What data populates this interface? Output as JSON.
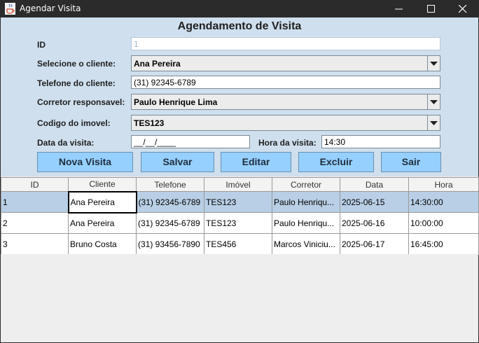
{
  "window": {
    "title": "Agendar Visita"
  },
  "form": {
    "title": "Agendamento de Visita",
    "id_label": "ID",
    "id_value": "1",
    "cliente_label": "Selecione o cliente:",
    "cliente_value": "Ana Pereira",
    "telefone_label": "Telefone do cliente:",
    "telefone_value": "(31) 92345-6789",
    "corretor_label": "Corretor responsavel:",
    "corretor_value": "Paulo Henrique Lima",
    "imovel_label": "Codigo do imovel:",
    "imovel_value": "TES123",
    "data_label": "Data da visita:",
    "data_value": "__/__/____",
    "hora_label": "Hora da visita:",
    "hora_value": "14:30"
  },
  "buttons": {
    "nova": "Nova Visita",
    "salvar": "Salvar",
    "editar": "Editar",
    "excluir": "Excluir",
    "sair": "Sair"
  },
  "table": {
    "headers": [
      "ID",
      "Cliente",
      "Telefone",
      "Imóvel",
      "Corretor",
      "Data",
      "Hora"
    ],
    "rows": [
      [
        "1",
        "Ana Pereira",
        "(31) 92345-6789",
        "TES123",
        "Paulo Henriqu...",
        "2025-06-15",
        "14:30:00"
      ],
      [
        "2",
        "Ana Pereira",
        "(31) 92345-6789",
        "TES123",
        "Paulo Henriqu...",
        "2025-06-16",
        "10:00:00"
      ],
      [
        "3",
        "Bruno Costa",
        "(31) 93456-7890",
        "TES456",
        "Marcos Viniciu...",
        "2025-06-17",
        "16:45:00"
      ]
    ]
  },
  "colors": {
    "form_background": "#cfdfee",
    "button_background": "#96d0ff",
    "selected_row": "#b8cfe5",
    "titlebar": "#2b2b2b"
  }
}
